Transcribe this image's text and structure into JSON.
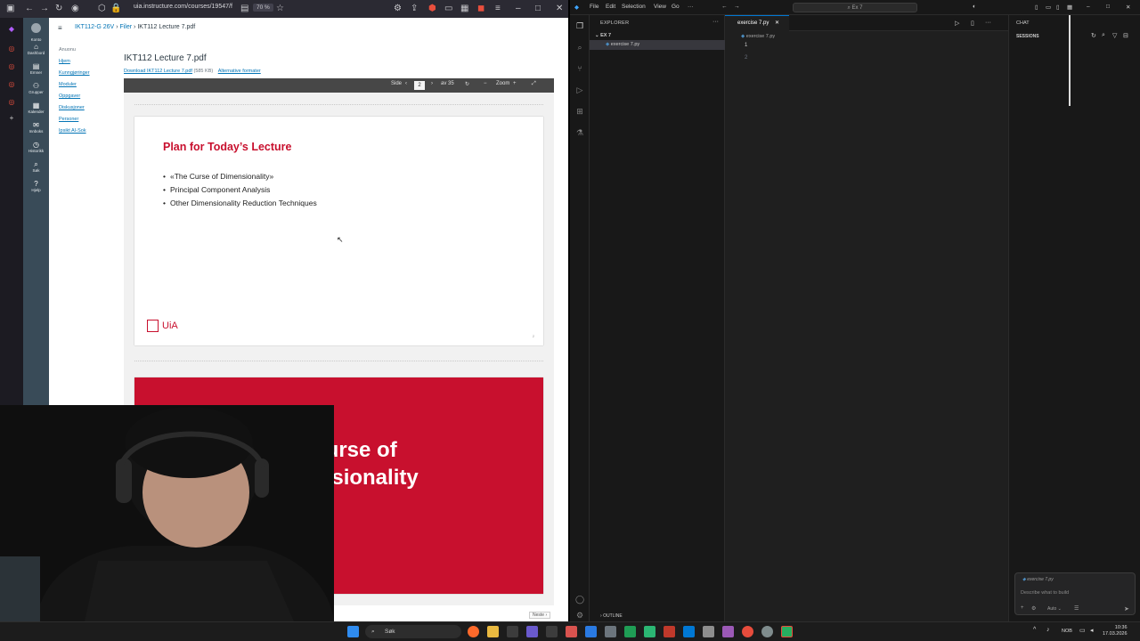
{
  "browser": {
    "url": "uia.instructure.com/courses/19547/f",
    "zoom": "70 %",
    "breadcrumb": {
      "course": "IKT112-G 26V",
      "section": "Filer",
      "file": "IKT112 Lecture 7.pdf"
    },
    "global_nav": [
      {
        "icon": "account-icon",
        "label": "Konto"
      },
      {
        "icon": "dashboard-icon",
        "label": "Dashbord"
      },
      {
        "icon": "courses-icon",
        "label": "Emner"
      },
      {
        "icon": "groups-icon",
        "label": "Grupper"
      },
      {
        "icon": "calendar-icon",
        "label": "Kalender"
      },
      {
        "icon": "inbox-icon",
        "label": "Innboks"
      },
      {
        "icon": "history-icon",
        "label": "Historikk"
      },
      {
        "icon": "search-icon",
        "label": "Søk"
      },
      {
        "icon": "help-icon",
        "label": "Hjelp"
      }
    ],
    "course_menu": [
      "Hjem",
      "Kunngjøringer",
      "Moduler",
      "Oppgaver",
      "Diskusjoner",
      "Personer",
      "Ipsikt AI-Sok"
    ],
    "course_menu_header": "Anuonu",
    "file_title": "IKT112 Lecture 7.pdf",
    "download_label": "Download IKT112 Lecture 7.pdf",
    "download_size": "(585 KB)",
    "alt_formats": "Alternative formater",
    "pdf_toolbar": {
      "page_label": "Side",
      "page_current": "2",
      "page_total": "av 35",
      "zoom": "Zoom",
      "next_label": "Neste ›"
    },
    "slide1": {
      "title": "Plan for Today’s Lecture",
      "bullets": [
        "«The Curse of Dimensionality»",
        "Principal Component Analysis",
        "Other Dimensionality Reduction Techniques"
      ],
      "logo_text": "UiA",
      "page_num": "2"
    },
    "slide2": {
      "title_line1": "The Curse of",
      "title_line2": "Dimensionality"
    }
  },
  "vscode": {
    "menus": [
      "File",
      "Edit",
      "Selection",
      "View",
      "Go",
      "···"
    ],
    "command_search": "Ex 7",
    "explorer_title": "EXPLORER",
    "folder": "EX 7",
    "files": [
      "exercise 7.py"
    ],
    "tab_label": "exercise 7.py",
    "editor_breadcrumb": "exercise 7.py",
    "line_numbers": [
      "1",
      "2"
    ],
    "outline_label": "OUTLINE",
    "chat_title": "CHAT",
    "sessions_title": "SESSIONS",
    "chat_context": "exercise 7.py",
    "chat_placeholder": "Describe what to build",
    "chat_mode": "Auto"
  },
  "taskbar": {
    "search": "Søk",
    "lang": "NOB",
    "time": "10:36",
    "date": "17.03.2026"
  },
  "colors": {
    "uia_red": "#c8102e",
    "canvas_nav": "#394b58",
    "vscode_bg": "#1f1f1f",
    "link_blue": "#0374b5"
  }
}
